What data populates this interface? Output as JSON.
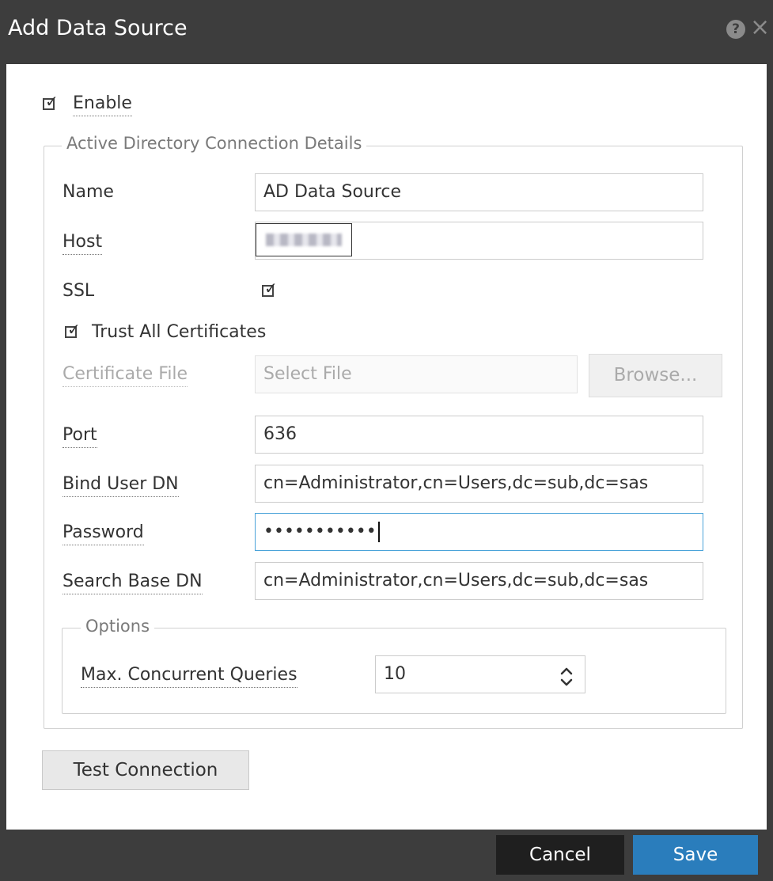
{
  "dialog": {
    "title": "Add Data Source",
    "help_icon": "help-icon",
    "close_icon": "close-icon"
  },
  "enable": {
    "label": "Enable",
    "checked": true
  },
  "ad_group": {
    "legend": "Active Directory Connection Details",
    "name": {
      "label": "Name",
      "value": "AD Data Source"
    },
    "host": {
      "label": "Host",
      "value": ""
    },
    "ssl": {
      "label": "SSL",
      "checked": true
    },
    "trust_all": {
      "label": "Trust All Certificates",
      "checked": true
    },
    "certificate": {
      "label": "Certificate File",
      "placeholder": "Select File",
      "browse_label": "Browse..."
    },
    "port": {
      "label": "Port",
      "value": "636"
    },
    "bind_user": {
      "label": "Bind User DN",
      "value": "cn=Administrator,cn=Users,dc=sub,dc=sas"
    },
    "password": {
      "label": "Password",
      "value": "•••••••••••"
    },
    "search_base": {
      "label": "Search Base DN",
      "value": "cn=Administrator,cn=Users,dc=sub,dc=sas"
    }
  },
  "options": {
    "legend": "Options",
    "max_queries": {
      "label": "Max. Concurrent Queries",
      "value": "10"
    }
  },
  "buttons": {
    "test_connection": "Test Connection",
    "cancel": "Cancel",
    "save": "Save"
  },
  "colors": {
    "header_bg": "#3d3d3d",
    "primary": "#2a7dbc",
    "focus": "#4aa3d9"
  }
}
